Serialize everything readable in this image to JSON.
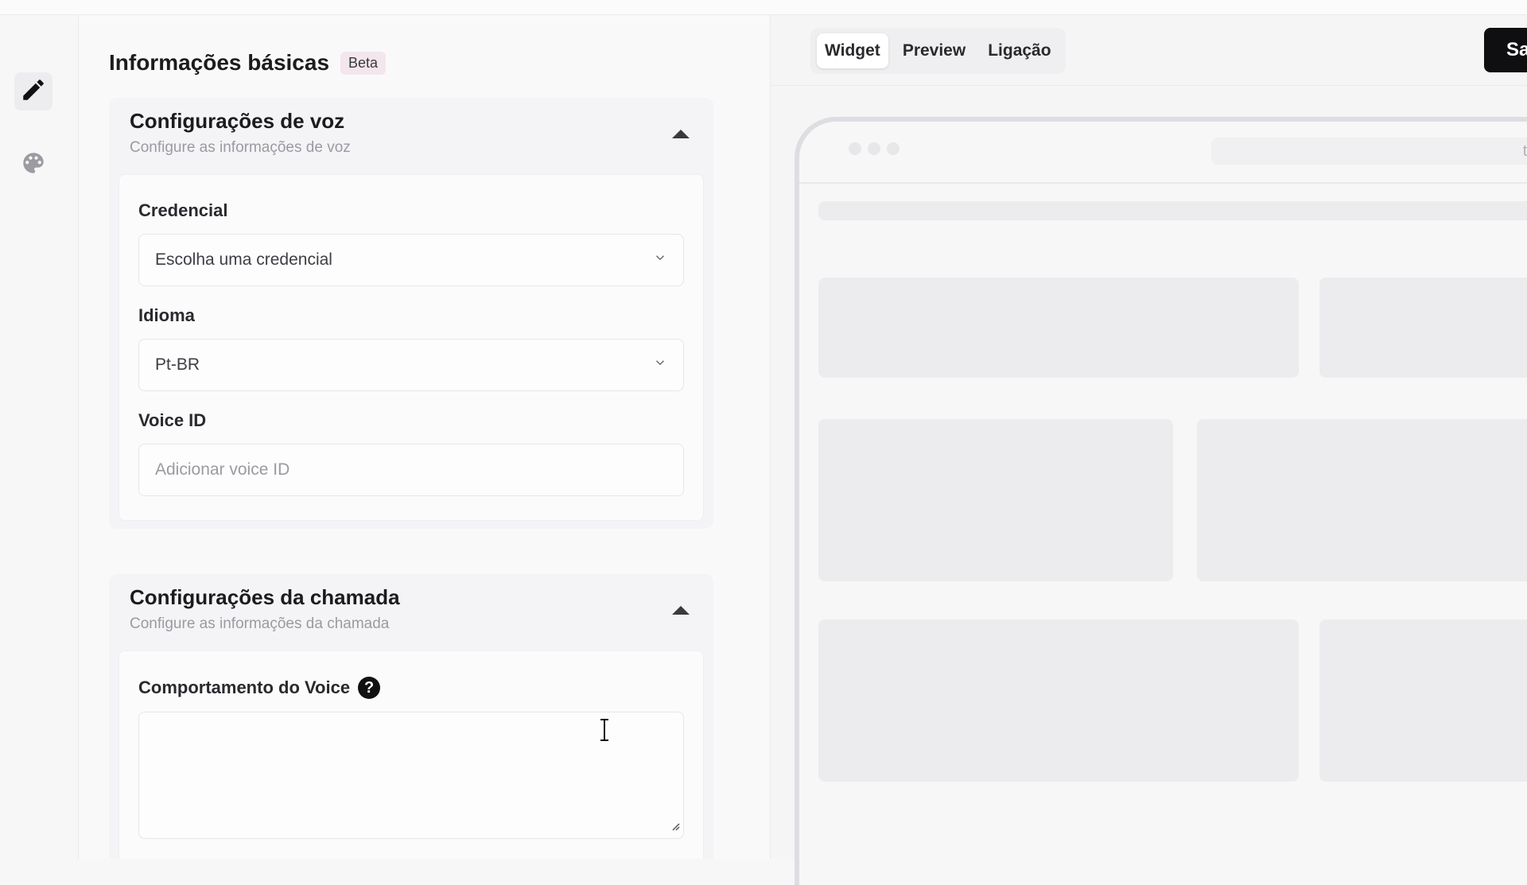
{
  "panel": {
    "title": "Informações básicas",
    "badge": "Beta"
  },
  "rail": {
    "items": [
      {
        "icon": "pencil-icon",
        "active": true
      },
      {
        "icon": "palette-icon",
        "active": false
      }
    ]
  },
  "voice_card": {
    "title": "Configurações de voz",
    "subtitle": "Configure as informações de voz",
    "credential_label": "Credencial",
    "credential_value": "Escolha uma credencial",
    "language_label": "Idioma",
    "language_value": "Pt-BR",
    "voice_id_label": "Voice ID",
    "voice_id_placeholder": "Adicionar voice ID"
  },
  "call_card": {
    "title": "Configurações da chamada",
    "subtitle": "Configure as informações da chamada",
    "behavior_label": "Comportamento do Voice",
    "help_glyph": "?"
  },
  "preview": {
    "tabs": [
      "Widget",
      "Preview",
      "Ligação"
    ],
    "active_tab": "Widget",
    "save_label": "Sa",
    "url_text": "toolz"
  }
}
